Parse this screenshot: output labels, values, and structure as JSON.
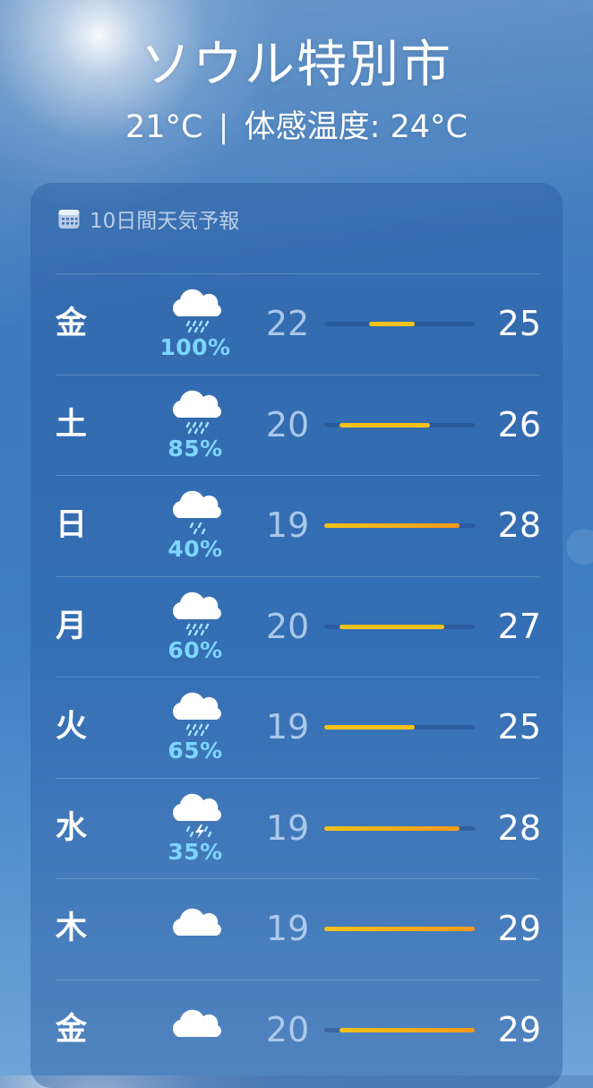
{
  "location": {
    "city": "ソウル特別市",
    "current_temp": "21°C",
    "separator": "|",
    "feels_like": "体感温度: 24°C"
  },
  "forecast": {
    "header_icon": "calendar-icon",
    "title": "10日間天気予報",
    "range_min": 19,
    "range_max": 29,
    "days": [
      {
        "day": "金",
        "icon": "cloud-rain-icon",
        "precip": "100%",
        "low": "22",
        "high": "25"
      },
      {
        "day": "土",
        "icon": "cloud-rain-icon",
        "precip": "85%",
        "low": "20",
        "high": "26"
      },
      {
        "day": "日",
        "icon": "cloud-drizzle-icon",
        "precip": "40%",
        "low": "19",
        "high": "28"
      },
      {
        "day": "月",
        "icon": "cloud-rain-icon",
        "precip": "60%",
        "low": "20",
        "high": "27"
      },
      {
        "day": "火",
        "icon": "cloud-rain-icon",
        "precip": "65%",
        "low": "19",
        "high": "25"
      },
      {
        "day": "水",
        "icon": "cloud-thunderstorm-icon",
        "precip": "35%",
        "low": "19",
        "high": "28"
      },
      {
        "day": "木",
        "icon": "cloud-icon",
        "precip": "",
        "low": "19",
        "high": "29"
      },
      {
        "day": "金",
        "icon": "cloud-icon",
        "precip": "",
        "low": "20",
        "high": "29"
      }
    ]
  },
  "colors": {
    "precip_text": "#7dd6ff",
    "bar_warm_start": "#f3c21a",
    "bar_warm_end": "#f59a1a"
  }
}
